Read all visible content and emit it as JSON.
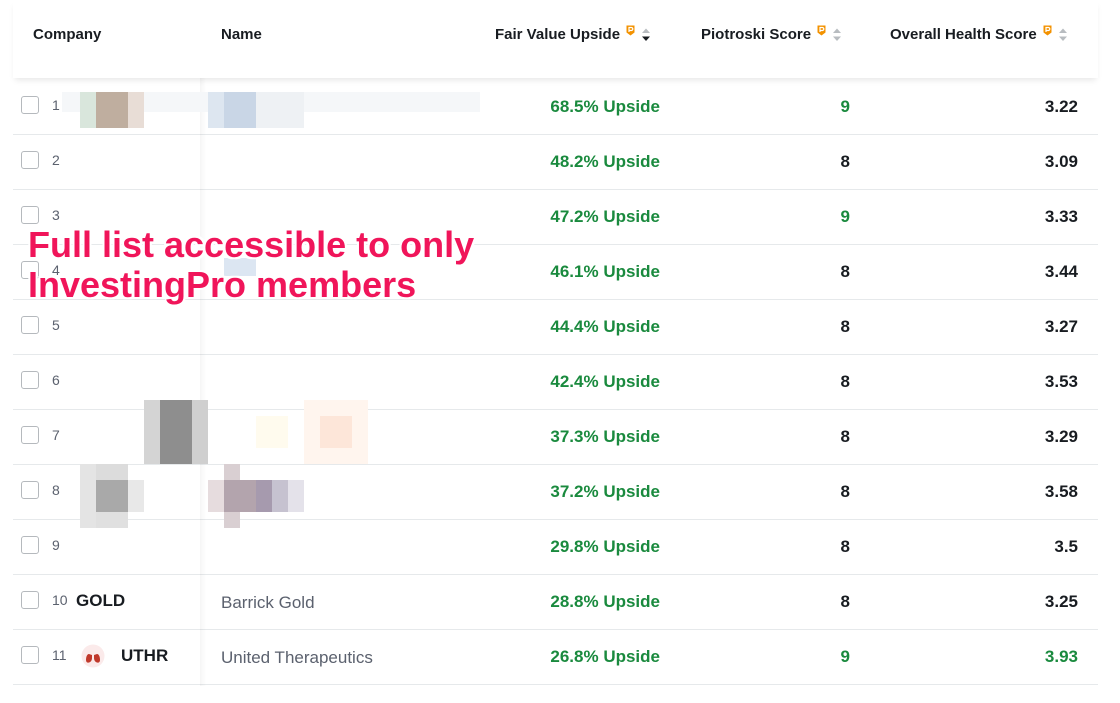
{
  "header": {
    "company": "Company",
    "name": "Name",
    "fair_value": "Fair Value Upside",
    "piotroski": "Piotroski Score",
    "health": "Overall Health Score"
  },
  "rows": [
    {
      "num": "1",
      "ticker": "",
      "name": "",
      "upside": "68.5% Upside",
      "piotroski": "9",
      "piotroski_color": "green",
      "health": "3.22",
      "health_color": "dark"
    },
    {
      "num": "2",
      "ticker": "",
      "name": "",
      "upside": "48.2% Upside",
      "piotroski": "8",
      "piotroski_color": "dark",
      "health": "3.09",
      "health_color": "dark"
    },
    {
      "num": "3",
      "ticker": "",
      "name": "",
      "upside": "47.2% Upside",
      "piotroski": "9",
      "piotroski_color": "green",
      "health": "3.33",
      "health_color": "dark"
    },
    {
      "num": "4",
      "ticker": "",
      "name": "",
      "upside": "46.1% Upside",
      "piotroski": "8",
      "piotroski_color": "dark",
      "health": "3.44",
      "health_color": "dark"
    },
    {
      "num": "5",
      "ticker": "",
      "name": "",
      "upside": "44.4% Upside",
      "piotroski": "8",
      "piotroski_color": "dark",
      "health": "3.27",
      "health_color": "dark"
    },
    {
      "num": "6",
      "ticker": "",
      "name": "",
      "upside": "42.4% Upside",
      "piotroski": "8",
      "piotroski_color": "dark",
      "health": "3.53",
      "health_color": "dark"
    },
    {
      "num": "7",
      "ticker": "",
      "name": "",
      "upside": "37.3% Upside",
      "piotroski": "8",
      "piotroski_color": "dark",
      "health": "3.29",
      "health_color": "dark"
    },
    {
      "num": "8",
      "ticker": "",
      "name": "",
      "upside": "37.2% Upside",
      "piotroski": "8",
      "piotroski_color": "dark",
      "health": "3.58",
      "health_color": "dark"
    },
    {
      "num": "9",
      "ticker": "",
      "name": "",
      "upside": "29.8% Upside",
      "piotroski": "8",
      "piotroski_color": "dark",
      "health": "3.5",
      "health_color": "dark"
    },
    {
      "num": "10",
      "ticker": "GOLD",
      "name": "Barrick Gold",
      "upside": "28.8% Upside",
      "piotroski": "8",
      "piotroski_color": "dark",
      "health": "3.25",
      "health_color": "dark"
    },
    {
      "num": "11",
      "ticker": "UTHR",
      "name": "United Therapeutics",
      "upside": "26.8% Upside",
      "piotroski": "9",
      "piotroski_color": "green",
      "health": "3.93",
      "health_color": "green",
      "logo": "lungs-icon"
    }
  ],
  "overlay": {
    "line1": "Full list accessible to only",
    "line2": "InvestingPro members"
  },
  "colors": {
    "upside_green": "#1a8a3e",
    "overlay_pink": "#f0155a",
    "pro_orange": "#f39200"
  }
}
